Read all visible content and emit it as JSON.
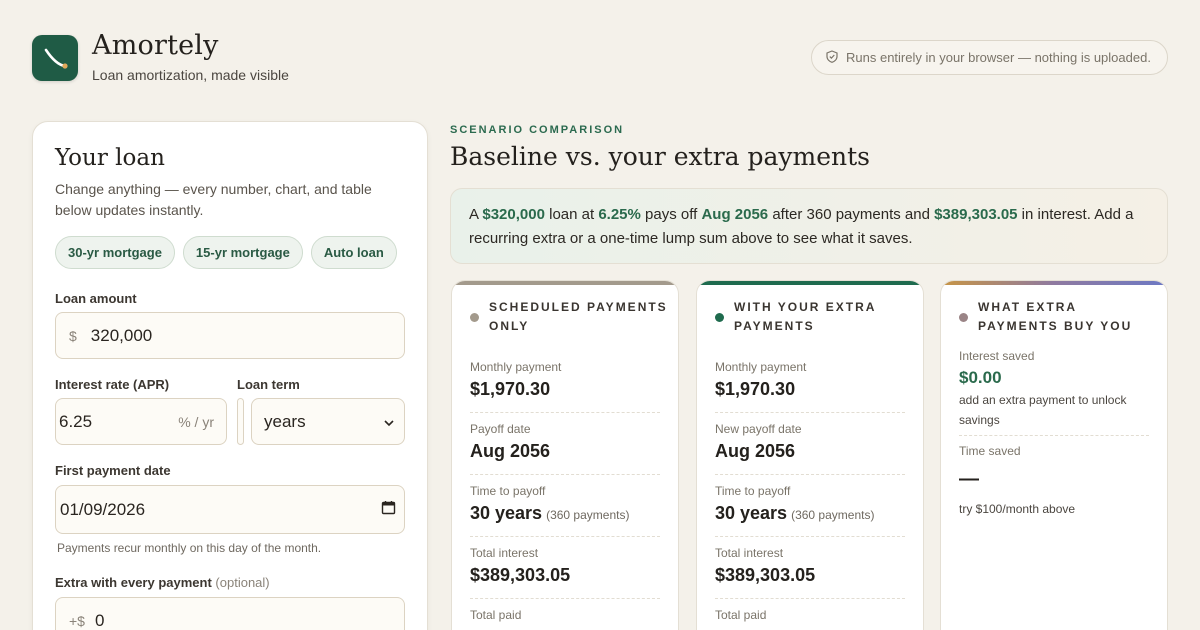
{
  "app": {
    "name": "Amortely",
    "tagline": "Loan amortization, made visible",
    "privacy_note": "Runs entirely in your browser — nothing is uploaded."
  },
  "loan_form": {
    "title": "Your loan",
    "description": "Change anything — every number, chart, and table below updates instantly.",
    "presets": [
      "30-yr mortgage",
      "15-yr mortgage",
      "Auto loan"
    ],
    "loan_amount": {
      "label": "Loan amount",
      "prefix": "$",
      "value": "320,000"
    },
    "interest_rate": {
      "label": "Interest rate (APR)",
      "value": "6.25",
      "suffix": "% / yr"
    },
    "loan_term": {
      "label": "Loan term",
      "value": "",
      "unit": "years"
    },
    "first_payment": {
      "label": "First payment date",
      "value": "01/09/2026",
      "hint": "Payments recur monthly on this day of the month."
    },
    "extra": {
      "label": "Extra with every payment",
      "optional": "(optional)",
      "prefix": "+$",
      "value": "0"
    }
  },
  "comparison": {
    "eyebrow": "SCENARIO COMPARISON",
    "title": "Baseline vs. your extra payments",
    "summary": {
      "t1": "A ",
      "amount": "$320,000",
      "t2": " loan at ",
      "rate": "6.25%",
      "t3": " pays off ",
      "payoff": "Aug 2056",
      "t4": " after 360 payments and ",
      "interest": "$389,303.05",
      "t5": " in interest. Add a recurring extra or a one-time lump sum above to see what it saves."
    },
    "baseline": {
      "title": "SCHEDULED PAYMENTS ONLY",
      "color": "#a39a8c",
      "monthly_label": "Monthly payment",
      "monthly_value": "$1,970.30",
      "payoff_label": "Payoff date",
      "payoff_value": "Aug 2056",
      "time_label": "Time to payoff",
      "time_value": "30 years",
      "time_note": "(360 payments)",
      "interest_label": "Total interest",
      "interest_value": "$389,303.05",
      "paid_label": "Total paid"
    },
    "extra": {
      "title": "WITH YOUR EXTRA PAYMENTS",
      "color": "#1f6b4e",
      "monthly_label": "Monthly payment",
      "monthly_value": "$1,970.30",
      "payoff_label": "New payoff date",
      "payoff_value": "Aug 2056",
      "time_label": "Time to payoff",
      "time_value": "30 years",
      "time_note": "(360 payments)",
      "interest_label": "Total interest",
      "interest_value": "$389,303.05",
      "paid_label": "Total paid"
    },
    "savings": {
      "title": "WHAT EXTRA PAYMENTS BUY YOU",
      "color": "#9a8486",
      "interest_saved_label": "Interest saved",
      "interest_saved_value": "$0.00",
      "interest_saved_note": "add an extra payment to unlock savings",
      "time_saved_label": "Time saved",
      "time_saved_value": "—",
      "time_saved_note": "try $100/month above"
    }
  }
}
